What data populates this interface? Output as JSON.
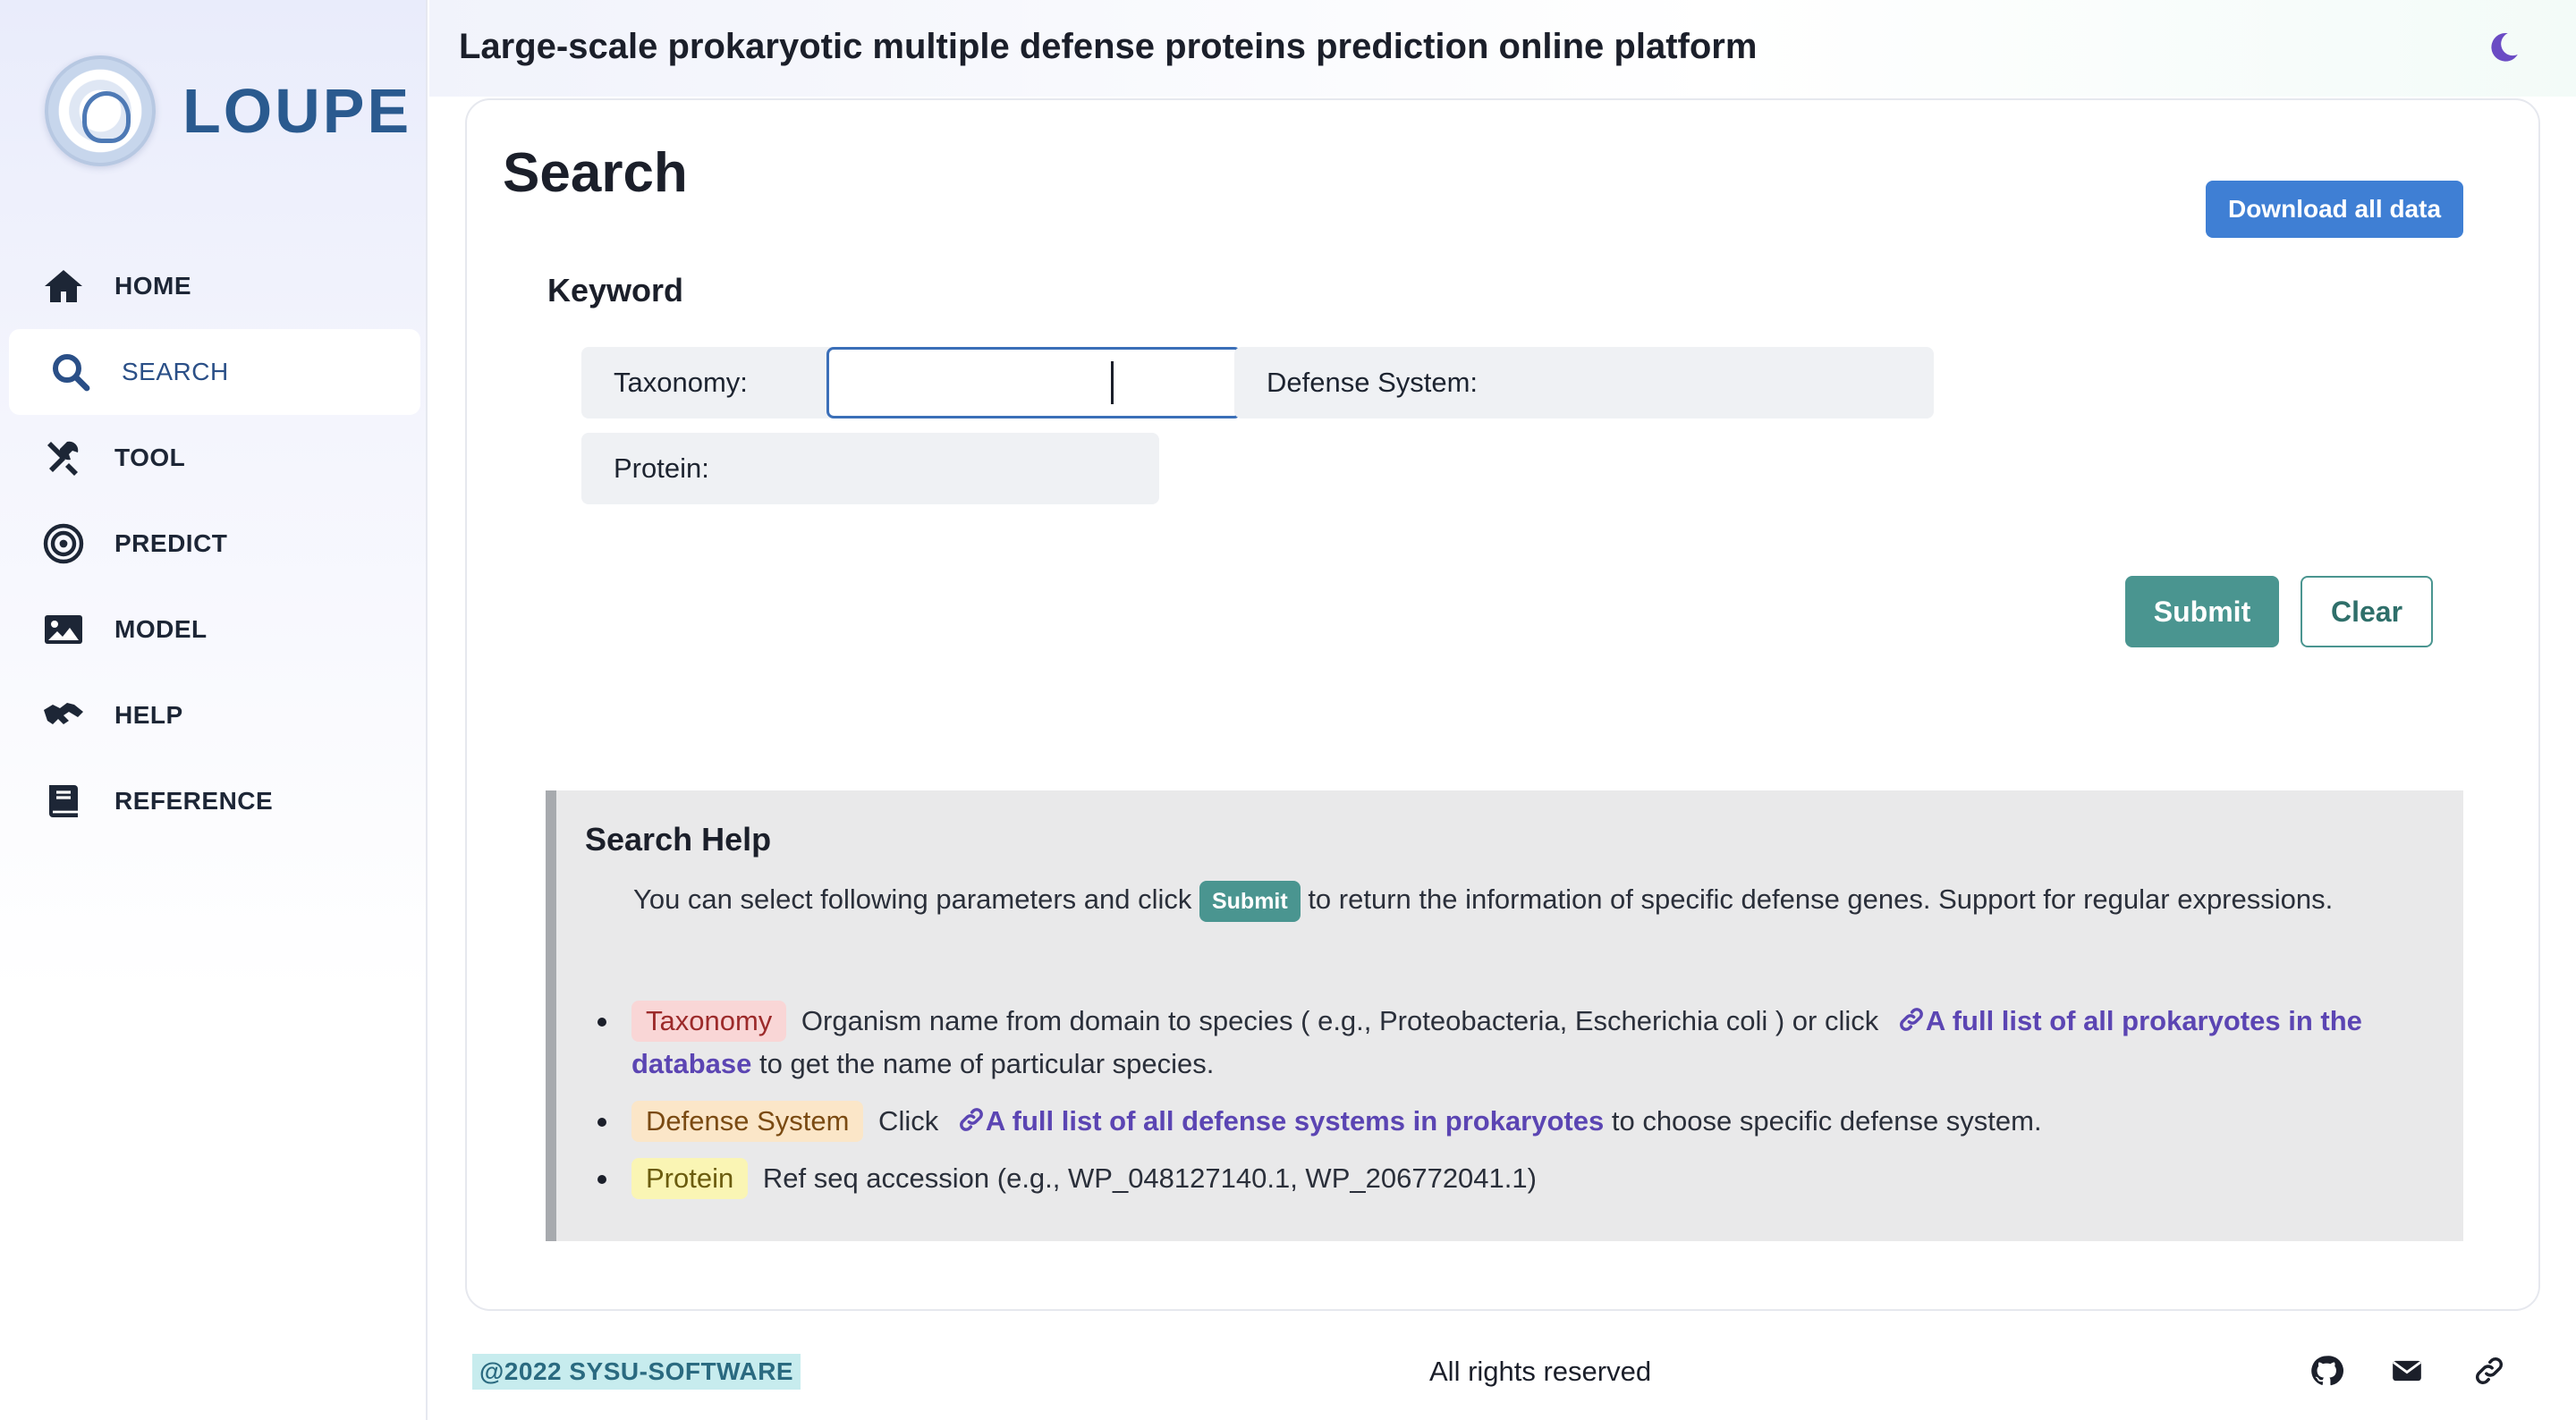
{
  "brand": {
    "name": "LOUPE"
  },
  "header": {
    "title": "Large-scale prokaryotic multiple defense proteins prediction online platform"
  },
  "nav": {
    "items": [
      {
        "label": "HOME",
        "icon": "home-icon"
      },
      {
        "label": "SEARCH",
        "icon": "search-icon",
        "active": true
      },
      {
        "label": "TOOL",
        "icon": "tools-icon"
      },
      {
        "label": "PREDICT",
        "icon": "target-icon"
      },
      {
        "label": "MODEL",
        "icon": "image-icon"
      },
      {
        "label": "HELP",
        "icon": "handshake-icon"
      },
      {
        "label": "REFERENCE",
        "icon": "book-icon"
      }
    ]
  },
  "page": {
    "title": "Search",
    "download_label": "Download all data",
    "keyword_label": "Keyword"
  },
  "fields": {
    "taxonomy_label": "Taxonomy:",
    "taxonomy_value": "",
    "defense_label": "Defense System:",
    "protein_label": "Protein:"
  },
  "actions": {
    "submit_label": "Submit",
    "clear_label": "Clear"
  },
  "help": {
    "title": "Search Help",
    "intro_before": "You can select following parameters and click ",
    "intro_button": "Submit",
    "intro_after": " to return the information of specific defense genes. Support for regular expressions.",
    "items": [
      {
        "tag": "Taxonomy",
        "text_before": " Organism name from domain to species ( e.g., Proteobacteria, Escherichia coli ) or click ",
        "link": "A full list of all prokaryotes in the database",
        "text_after": " to get the name of particular species."
      },
      {
        "tag": "Defense System",
        "text_before": " Click ",
        "link": "A full list of all defense systems in prokaryotes",
        "text_after": " to choose specific defense system."
      },
      {
        "tag": "Protein",
        "text_before": " Ref seq accession (e.g., WP_048127140.1, WP_206772041.1)"
      }
    ]
  },
  "footer": {
    "copyright": "@2022 SYSU-SOFTWARE",
    "rights": "All rights reserved",
    "icons": [
      "github-icon",
      "mail-icon",
      "link-icon"
    ]
  },
  "colors": {
    "accent_teal": "#4a9590",
    "accent_blue": "#3f7fd4",
    "link_purple": "#5b45b3",
    "brand_blue": "#2a5a8f"
  }
}
